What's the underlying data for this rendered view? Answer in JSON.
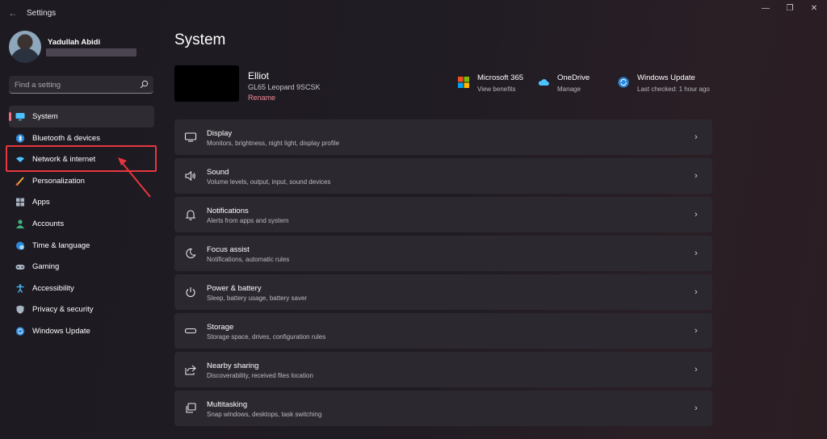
{
  "window": {
    "title": "Settings",
    "back_icon": "back-arrow-icon",
    "controls": {
      "minimize": "—",
      "maximize": "❐",
      "close": "✕"
    }
  },
  "profile": {
    "name": "Yadullah Abidi"
  },
  "search": {
    "placeholder": "Find a setting",
    "value": ""
  },
  "sidebar": {
    "items": [
      {
        "label": "System",
        "icon": "monitor-icon",
        "selected": true
      },
      {
        "label": "Bluetooth & devices",
        "icon": "bluetooth-icon"
      },
      {
        "label": "Network & internet",
        "icon": "wifi-icon"
      },
      {
        "label": "Personalization",
        "icon": "brush-icon"
      },
      {
        "label": "Apps",
        "icon": "apps-icon"
      },
      {
        "label": "Accounts",
        "icon": "person-icon"
      },
      {
        "label": "Time & language",
        "icon": "globe-clock-icon"
      },
      {
        "label": "Gaming",
        "icon": "gamepad-icon"
      },
      {
        "label": "Accessibility",
        "icon": "accessibility-icon"
      },
      {
        "label": "Privacy & security",
        "icon": "shield-icon"
      },
      {
        "label": "Windows Update",
        "icon": "update-icon"
      }
    ]
  },
  "annotation": {
    "color": "#e8363e",
    "target": "Network & internet"
  },
  "main": {
    "title": "System",
    "device": {
      "name": "Elliot",
      "model": "GL65 Leopard 9SCSK",
      "rename": "Rename"
    },
    "quick_links": [
      {
        "title": "Microsoft 365",
        "subtitle": "View benefits",
        "icon": "microsoft-logo-icon"
      },
      {
        "title": "OneDrive",
        "subtitle": "Manage",
        "icon": "cloud-icon"
      },
      {
        "title": "Windows Update",
        "subtitle": "Last checked: 1 hour ago",
        "icon": "update-icon"
      }
    ],
    "settings": [
      {
        "title": "Display",
        "desc": "Monitors, brightness, night light, display profile",
        "icon": "display-icon"
      },
      {
        "title": "Sound",
        "desc": "Volume levels, output, input, sound devices",
        "icon": "speaker-icon"
      },
      {
        "title": "Notifications",
        "desc": "Alerts from apps and system",
        "icon": "bell-icon"
      },
      {
        "title": "Focus assist",
        "desc": "Notifications, automatic rules",
        "icon": "moon-icon"
      },
      {
        "title": "Power & battery",
        "desc": "Sleep, battery usage, battery saver",
        "icon": "power-icon"
      },
      {
        "title": "Storage",
        "desc": "Storage space, drives, configuration rules",
        "icon": "storage-icon"
      },
      {
        "title": "Nearby sharing",
        "desc": "Discoverability, received files location",
        "icon": "share-icon"
      },
      {
        "title": "Multitasking",
        "desc": "Snap windows, desktops, task switching",
        "icon": "multitask-icon"
      }
    ]
  },
  "colors": {
    "accent": "#f06b7c",
    "card_bg": "#2c2830",
    "window_bg": "#1f1b22",
    "link": "#f08b98"
  }
}
